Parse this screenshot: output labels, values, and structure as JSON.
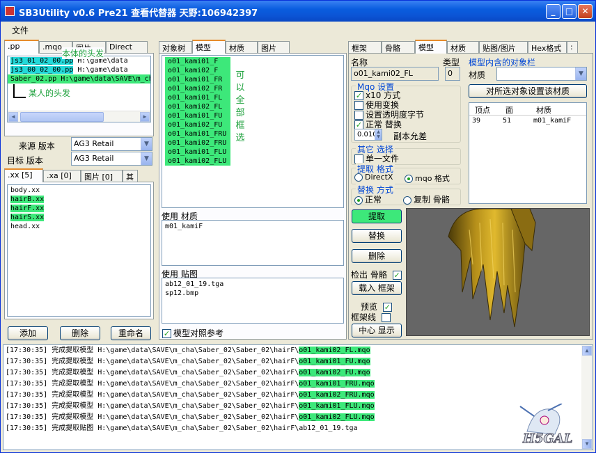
{
  "window": {
    "title": "SB3Utility v0.6 Pre21 查看代替器 天野:106942397"
  },
  "menu": {
    "file": "文件"
  },
  "left": {
    "tabs": [
      ".pp",
      ".mqo",
      "图片",
      "Direct"
    ],
    "pp_list": [
      {
        "name": "js3_01_02_00.pp",
        "path": "H:\\game\\data"
      },
      {
        "name": "js3_00_02_00.pp",
        "path": "H:\\game\\data"
      },
      {
        "name": "Saber_02.pp",
        "path": "H:\\game\\data\\SAVE\\m_cha"
      }
    ],
    "annot_body": "本体的头发",
    "annot_person": "某人的头发",
    "source_label": "来源 版本",
    "source_value": "AG3 Retail",
    "target_label": "目标 版本",
    "target_value": "AG3 Retail",
    "sub_tabs": [
      ".xx [5]",
      ".xa [0]",
      "图片 [0]",
      "其"
    ],
    "xx_list": [
      "body.xx",
      "hairB.xx",
      "hairF.xx",
      "hairS.xx",
      "head.xx"
    ],
    "btn_add": "添加",
    "btn_delete": "删除",
    "btn_rename": "重命名"
  },
  "mid": {
    "tabs": [
      "对象树",
      "模型",
      "材质",
      "图片"
    ],
    "meshes": [
      "o01_kami01_F",
      "o01_kami02_F",
      "o01_kami01_FR",
      "o01_kami02_FR",
      "o01_kami01_FL",
      "o01_kami02_FL",
      "o01_kami01_FU",
      "o01_kami02_FU",
      "o01_kami01_FRU",
      "o01_kami02_FRU",
      "o01_kami01_FLU",
      "o01_kami02_FLU"
    ],
    "annot_chars": [
      "可",
      "以",
      "全",
      "部",
      "框",
      "选"
    ],
    "used_material_label": "使用 材质",
    "used_materials": [
      "m01_kamiF"
    ],
    "used_texture_label": "使用 贴图",
    "used_textures": [
      "ab12_01_19.tga",
      "sp12.bmp"
    ],
    "compare_label": "模型对照参考"
  },
  "right": {
    "tabs": [
      "框架",
      "骨骼",
      "模型",
      "材质",
      "贴图/图片",
      "Hex格式"
    ],
    "name_label": "名称",
    "name_value": "o01_kami02_FL",
    "type_label": "类型",
    "type_value": "0",
    "mqo_group": "Mqo 设置",
    "mqo_opts": [
      {
        "label": "x10 方式",
        "checked": true
      },
      {
        "label": "使用变换",
        "checked": false
      },
      {
        "label": "设置透明度字节",
        "checked": false
      },
      {
        "label": "正常 替换",
        "checked": true
      }
    ],
    "epsilon_value": "0.010",
    "epsilon_label": "副本允差",
    "other_group": "其它 选择",
    "single_file": "单一文件",
    "export_group": "提取 格式",
    "fmt_directx": "DirectX",
    "fmt_mqo": "mqo 格式",
    "replace_group": "替换 方式",
    "rep_normal": "正常",
    "rep_copy_bone": "复制 骨骼",
    "btn_export": "提取",
    "btn_replace": "替换",
    "btn_delete": "删除",
    "bone_detect_label": "检出 骨骼",
    "btn_load_frame": "载入 框架",
    "preview_label": "预览",
    "frame_line_label": "框架线",
    "btn_center": "中心 显示",
    "objbar_title": "模型内含的对象栏",
    "material_label": "材质",
    "btn_set_material": "对所选对象设置该材质",
    "grid_headers": [
      "顶点",
      "面",
      "材质"
    ],
    "grid_rows": [
      [
        "39",
        "51",
        "m01_kamiF"
      ]
    ]
  },
  "log": [
    {
      "prefix": "[17:30:35] 完成提取模型 H:\\game\\data\\SAVE\\m_cha\\Saber_02\\Saber_02\\hairF\\",
      "file": "o01_kami02_FL.mqo"
    },
    {
      "prefix": "[17:30:35] 完成提取模型 H:\\game\\data\\SAVE\\m_cha\\Saber_02\\Saber_02\\hairF\\",
      "file": "o01_kami01_FU.mqo"
    },
    {
      "prefix": "[17:30:35] 完成提取模型 H:\\game\\data\\SAVE\\m_cha\\Saber_02\\Saber_02\\hairF\\",
      "file": "o01_kami02_FU.mqo"
    },
    {
      "prefix": "[17:30:35] 完成提取模型 H:\\game\\data\\SAVE\\m_cha\\Saber_02\\Saber_02\\hairF\\",
      "file": "o01_kami01_FRU.mqo"
    },
    {
      "prefix": "[17:30:35] 完成提取模型 H:\\game\\data\\SAVE\\m_cha\\Saber_02\\Saber_02\\hairF\\",
      "file": "o01_kami02_FRU.mqo"
    },
    {
      "prefix": "[17:30:35] 完成提取模型 H:\\game\\data\\SAVE\\m_cha\\Saber_02\\Saber_02\\hairF\\",
      "file": "o01_kami01_FLU.mqo"
    },
    {
      "prefix": "[17:30:35] 完成提取模型 H:\\game\\data\\SAVE\\m_cha\\Saber_02\\Saber_02\\hairF\\",
      "file": "o01_kami02_FLU.mqo"
    },
    {
      "prefix": "[17:30:35] 完成提取贴图 H:\\game\\data\\SAVE\\m_cha\\Saber_02\\Saber_02\\hairF\\ab12_01_19.tga",
      "file": ""
    }
  ],
  "watermark": "H5GAL"
}
